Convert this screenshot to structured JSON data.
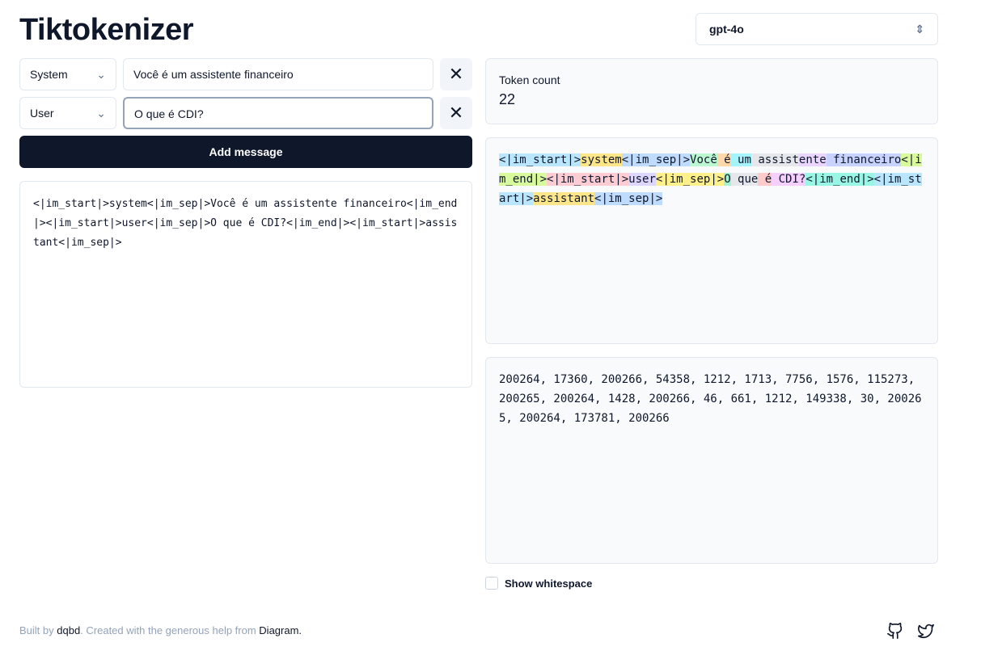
{
  "title": "Tiktokenizer",
  "model": "gpt-4o",
  "messages": [
    {
      "role": "System",
      "content": "Você é um assistente financeiro"
    },
    {
      "role": "User",
      "content": "O que é CDI?"
    }
  ],
  "add_message": "Add message",
  "raw_text": "<|im_start|>system<|im_sep|>Você é um assistente financeiro<|im_end|><|im_start|>user<|im_sep|>O que é CDI?<|im_end|><|im_start|>assistant<|im_sep|>",
  "token_count_label": "Token count",
  "token_count": "22",
  "tokens": [
    {
      "t": "<|im_start|>",
      "c": "#bae6fd"
    },
    {
      "t": "system",
      "c": "#fde68a"
    },
    {
      "t": "<|im_sep|>",
      "c": "#bfdbfe"
    },
    {
      "t": "Você",
      "c": "#bbf7d0"
    },
    {
      "t": " é",
      "c": "#fed7aa"
    },
    {
      "t": " um",
      "c": "#a5f3fc"
    },
    {
      "t": " assist",
      "c": "#e5e7eb"
    },
    {
      "t": "ente",
      "c": "#e9d5ff"
    },
    {
      "t": " financeiro",
      "c": "#c7d2fe"
    },
    {
      "t": "<|im_end|>",
      "c": "#d9f99d"
    },
    {
      "t": "<|im_start|>",
      "c": "#fecdd3"
    },
    {
      "t": "user",
      "c": "#ddd6fe"
    },
    {
      "t": "<|im_sep|>",
      "c": "#fef08a"
    },
    {
      "t": "O",
      "c": "#a7f3d0"
    },
    {
      "t": " que",
      "c": "#e5e7eb"
    },
    {
      "t": " é",
      "c": "#fecaca"
    },
    {
      "t": " CDI",
      "c": "#f5d0fe"
    },
    {
      "t": "?",
      "c": "#f5d0fe"
    },
    {
      "t": "<|im_end|>",
      "c": "#99f6e4"
    },
    {
      "t": "<|im_start|>",
      "c": "#bae6fd"
    },
    {
      "t": "assistant",
      "c": "#fde68a"
    },
    {
      "t": "<|im_sep|>",
      "c": "#bfdbfe"
    }
  ],
  "token_ids": "200264, 17360, 200266, 54358, 1212, 1713, 7756, 1576, 115273, 200265, 200264, 1428, 200266, 46, 661, 1212, 149338, 30, 200265, 200264, 173781, 200266",
  "show_whitespace": "Show whitespace",
  "footer": {
    "built_by": "Built by ",
    "author": "dqbd",
    "created": ". Created with the generous help from ",
    "diagram": "Diagram",
    "end": "."
  }
}
